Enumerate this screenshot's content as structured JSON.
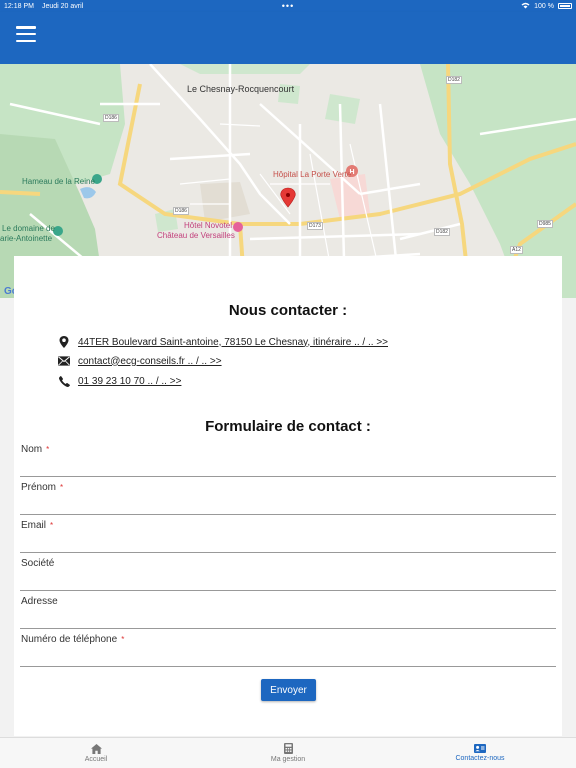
{
  "status_bar": {
    "time": "12:18 PM",
    "date": "Jeudi 20 avril",
    "dots": "•••",
    "battery": "100 %"
  },
  "map": {
    "labels": {
      "town": "Le Chesnay-Rocquencourt",
      "hameau": "Hameau de la Reine",
      "domaine_line1": "Le domaine de",
      "domaine_line2": "arie-Antoinette",
      "hotel_line1": "Hôtel Novotel",
      "hotel_line2": "Château de Versailles",
      "hopital": "Hôpital La Porte Verte",
      "google": "Go"
    },
    "roads": {
      "d186a": "D186",
      "d186b": "D186",
      "d173": "D173",
      "d182a": "D182",
      "d182b": "D182",
      "d985": "D985",
      "a12": "A12"
    }
  },
  "contact": {
    "title": "Nous contacter :",
    "address": "44TER Boulevard Saint-antoine, 78150 Le Chesnay, itinéraire .. / .. >>",
    "email": "contact@ecg-conseils.fr .. / .. >>",
    "phone": "01 39 23 10 70 .. / .. >>"
  },
  "form": {
    "title": "Formulaire de contact :",
    "fields": [
      {
        "label": "Nom",
        "required": "*"
      },
      {
        "label": "Prénom",
        "required": "*"
      },
      {
        "label": "Email",
        "required": "*"
      },
      {
        "label": "Société",
        "required": ""
      },
      {
        "label": "Adresse",
        "required": ""
      },
      {
        "label": "Numéro de téléphone",
        "required": "*"
      }
    ],
    "submit_label": "Envoyer"
  },
  "bottom_nav": {
    "items": [
      {
        "label": "Accueil",
        "icon": "home-icon"
      },
      {
        "label": "Ma gestion",
        "icon": "calculator-icon"
      },
      {
        "label": "Contactez-nous",
        "icon": "contact-card-icon"
      }
    ],
    "active": "Contactez-nous"
  },
  "colors": {
    "primary": "#1d67c0",
    "marker": "#e53935",
    "required": "#dd3333"
  }
}
